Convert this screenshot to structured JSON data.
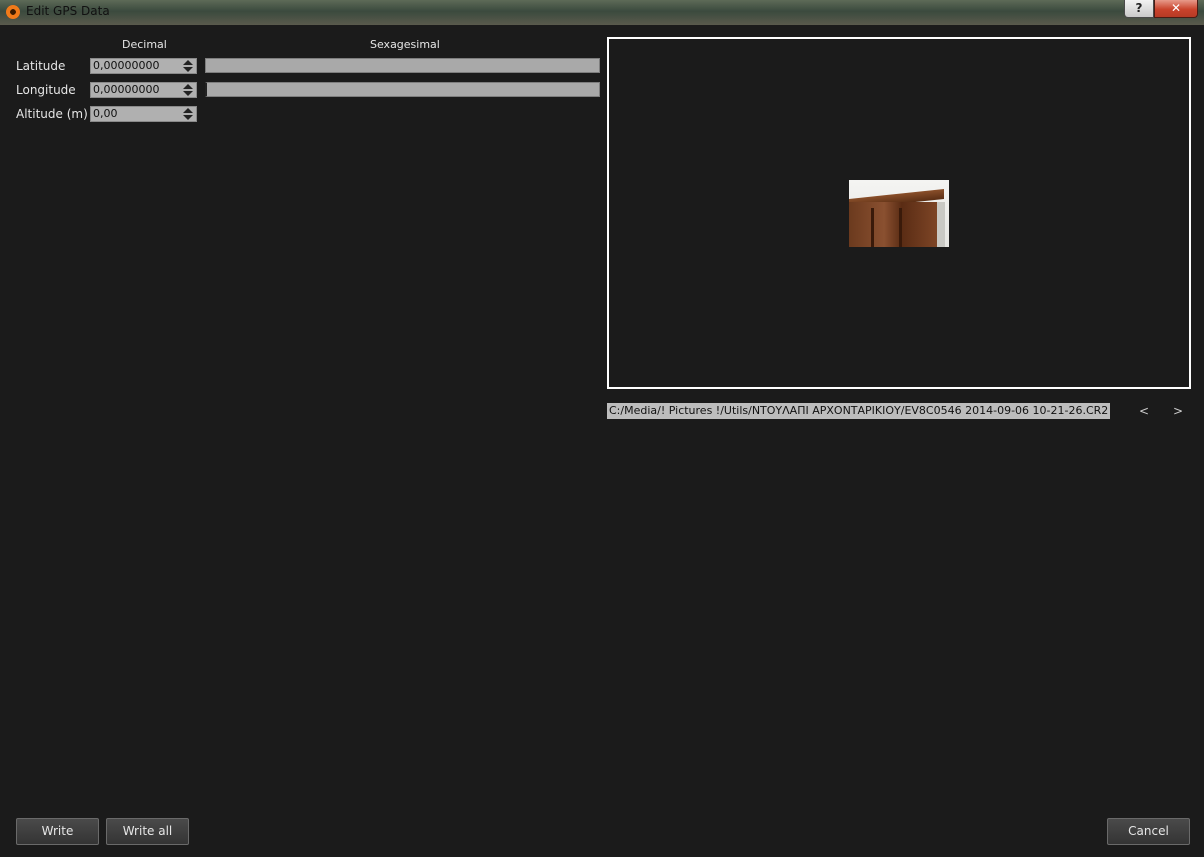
{
  "window": {
    "title": "Edit GPS Data",
    "help_label": "?",
    "close_label": "✕"
  },
  "form": {
    "decimal_header": "Decimal",
    "sexagesimal_header": "Sexagesimal",
    "latitude_label": "Latitude",
    "longitude_label": "Longitude",
    "altitude_label": "Altitude (m)",
    "latitude_value": "0,00000000",
    "longitude_value": "0,00000000",
    "altitude_value": "0,00",
    "latitude_sexagesimal": "",
    "longitude_sexagesimal": ""
  },
  "preview": {
    "file_path": "C:/Media/! Pictures !/Utils/ΝΤΟΥΛΑΠΙ ΑΡΧΟΝΤΑΡΙΚΙΟΥ/EV8C0546 2014-09-06 10-21-26.CR2",
    "prev_label": "<",
    "next_label": ">"
  },
  "buttons": {
    "write": "Write",
    "write_all": "Write all",
    "cancel": "Cancel"
  },
  "colors": {
    "background": "#1b1b1b",
    "field": "#b0b0b0",
    "close_button": "#c9432c"
  }
}
